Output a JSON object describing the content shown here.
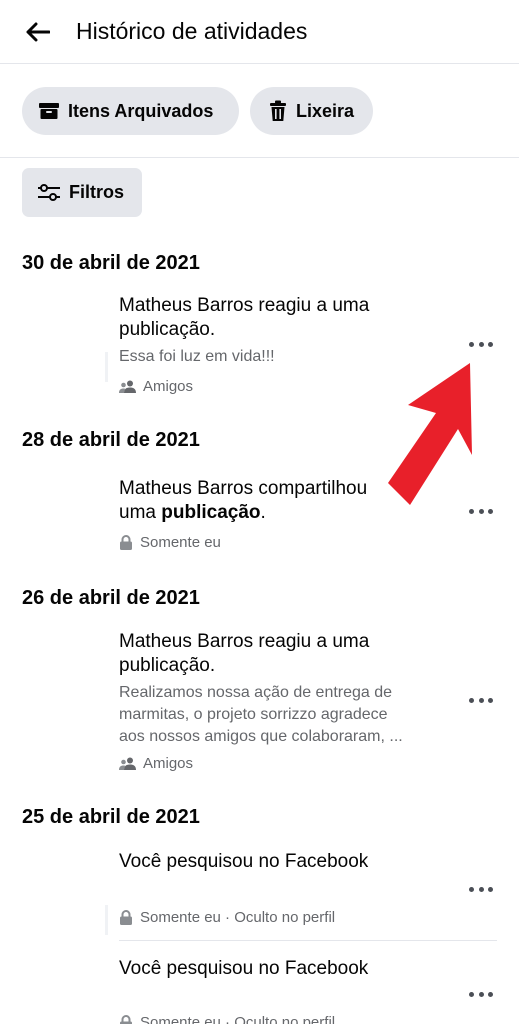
{
  "header": {
    "title": "Histórico de atividades",
    "back_icon": "arrow-left-icon"
  },
  "toolbar": {
    "archived_label": "Itens Arquivados",
    "trash_label": "Lixeira",
    "filters_label": "Filtros"
  },
  "sections": [
    {
      "date": "30 de abril de 2021",
      "entries": [
        {
          "title_plain": "Matheus Barros reagiu a uma publicação.",
          "title_line1": "Matheus Barros reagiu a uma",
          "title_line2": "publicação.",
          "description": "Essa foi luz em vida!!!",
          "audience": "Amigos",
          "audience_icon": "friends-icon"
        }
      ]
    },
    {
      "date": "28 de abril de 2021",
      "entries": [
        {
          "title_line1": "Matheus Barros compartilhou",
          "title_line2_prefix": "uma ",
          "title_line2_bold": "publicação",
          "title_line2_suffix": ".",
          "audience": "Somente eu",
          "audience_icon": "lock-icon"
        }
      ]
    },
    {
      "date": "26 de abril de 2021",
      "entries": [
        {
          "title_line1": "Matheus Barros reagiu a uma",
          "title_line2": "publicação.",
          "description_line1": "Realizamos nossa ação de entrega de",
          "description_line2": "marmitas, o projeto sorrizzo agradece",
          "description_line3": "aos nossos amigos que colaboraram, ...",
          "audience": "Amigos",
          "audience_icon": "friends-icon"
        }
      ]
    },
    {
      "date": "25 de abril de 2021",
      "entries": [
        {
          "title": "Você pesquisou no Facebook",
          "audience": "Somente eu · Oculto no perfil",
          "audience_icon": "lock-icon"
        },
        {
          "title": "Você pesquisou no Facebook",
          "audience": "Somente eu · Oculto no perfil",
          "audience_icon": "lock-icon"
        }
      ]
    }
  ],
  "colors": {
    "text_primary": "#050505",
    "text_secondary": "#65676b",
    "button_bg": "#e4e6eb",
    "annotation_arrow": "#e8202a"
  }
}
